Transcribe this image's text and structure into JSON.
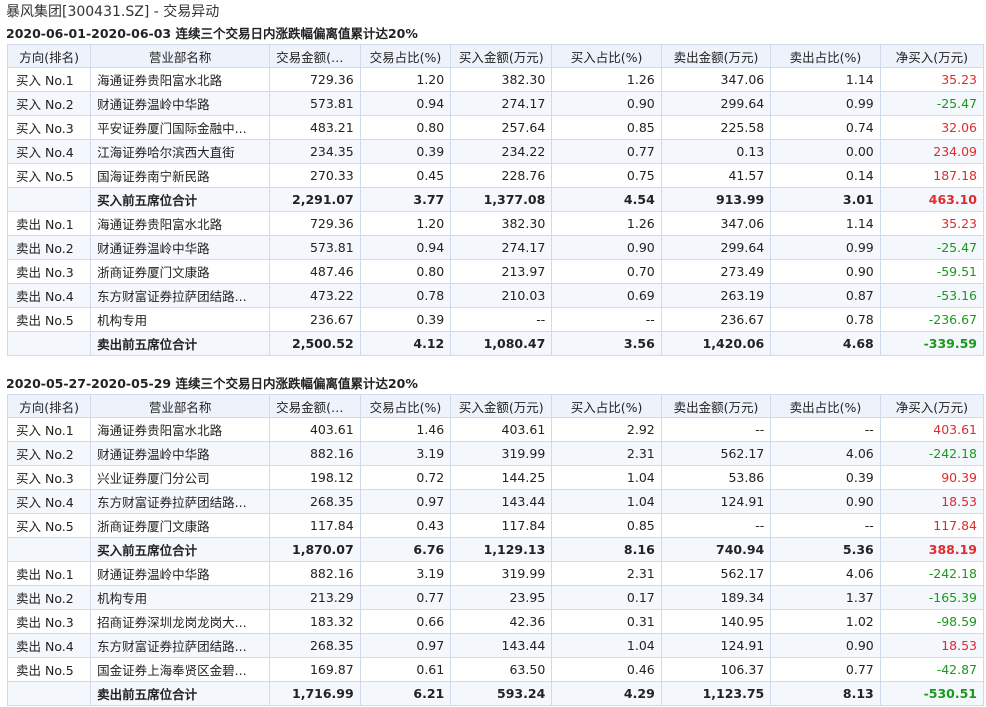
{
  "page_title": "暴风集团[300431.SZ] - 交易异动",
  "columns": [
    "方向(排名)",
    "营业部名称",
    "交易金额(万元)",
    "交易占比(%)",
    "买入金额(万元)",
    "买入占比(%)",
    "卖出金额(万元)",
    "卖出占比(%)",
    "净买入(万元)"
  ],
  "sections": [
    {
      "title": "2020-06-01-2020-06-03 连续三个交易日内涨跌幅偏离值累计达20%",
      "rows": [
        {
          "dir": "买入 No.1",
          "dept": "海通证券贵阳富水北路",
          "amt": "729.36",
          "ratio": "1.20",
          "buy": "382.30",
          "buy_ratio": "1.26",
          "sell": "347.06",
          "sell_ratio": "1.14",
          "net": "35.23",
          "total": false
        },
        {
          "dir": "买入 No.2",
          "dept": "财通证券温岭中华路",
          "amt": "573.81",
          "ratio": "0.94",
          "buy": "274.17",
          "buy_ratio": "0.90",
          "sell": "299.64",
          "sell_ratio": "0.99",
          "net": "-25.47",
          "total": false
        },
        {
          "dir": "买入 No.3",
          "dept": "平安证券厦门国际金融中...",
          "amt": "483.21",
          "ratio": "0.80",
          "buy": "257.64",
          "buy_ratio": "0.85",
          "sell": "225.58",
          "sell_ratio": "0.74",
          "net": "32.06",
          "total": false
        },
        {
          "dir": "买入 No.4",
          "dept": "江海证券哈尔滨西大直街",
          "amt": "234.35",
          "ratio": "0.39",
          "buy": "234.22",
          "buy_ratio": "0.77",
          "sell": "0.13",
          "sell_ratio": "0.00",
          "net": "234.09",
          "total": false
        },
        {
          "dir": "买入 No.5",
          "dept": "国海证券南宁新民路",
          "amt": "270.33",
          "ratio": "0.45",
          "buy": "228.76",
          "buy_ratio": "0.75",
          "sell": "41.57",
          "sell_ratio": "0.14",
          "net": "187.18",
          "total": false
        },
        {
          "dir": "",
          "dept": "买入前五席位合计",
          "amt": "2,291.07",
          "ratio": "3.77",
          "buy": "1,377.08",
          "buy_ratio": "4.54",
          "sell": "913.99",
          "sell_ratio": "3.01",
          "net": "463.10",
          "total": true
        },
        {
          "dir": "卖出 No.1",
          "dept": "海通证券贵阳富水北路",
          "amt": "729.36",
          "ratio": "1.20",
          "buy": "382.30",
          "buy_ratio": "1.26",
          "sell": "347.06",
          "sell_ratio": "1.14",
          "net": "35.23",
          "total": false
        },
        {
          "dir": "卖出 No.2",
          "dept": "财通证券温岭中华路",
          "amt": "573.81",
          "ratio": "0.94",
          "buy": "274.17",
          "buy_ratio": "0.90",
          "sell": "299.64",
          "sell_ratio": "0.99",
          "net": "-25.47",
          "total": false
        },
        {
          "dir": "卖出 No.3",
          "dept": "浙商证券厦门文康路",
          "amt": "487.46",
          "ratio": "0.80",
          "buy": "213.97",
          "buy_ratio": "0.70",
          "sell": "273.49",
          "sell_ratio": "0.90",
          "net": "-59.51",
          "total": false
        },
        {
          "dir": "卖出 No.4",
          "dept": "东方财富证券拉萨团结路...",
          "amt": "473.22",
          "ratio": "0.78",
          "buy": "210.03",
          "buy_ratio": "0.69",
          "sell": "263.19",
          "sell_ratio": "0.87",
          "net": "-53.16",
          "total": false
        },
        {
          "dir": "卖出 No.5",
          "dept": "机构专用",
          "amt": "236.67",
          "ratio": "0.39",
          "buy": "--",
          "buy_ratio": "--",
          "sell": "236.67",
          "sell_ratio": "0.78",
          "net": "-236.67",
          "total": false
        },
        {
          "dir": "",
          "dept": "卖出前五席位合计",
          "amt": "2,500.52",
          "ratio": "4.12",
          "buy": "1,080.47",
          "buy_ratio": "3.56",
          "sell": "1,420.06",
          "sell_ratio": "4.68",
          "net": "-339.59",
          "total": true
        }
      ]
    },
    {
      "title": "2020-05-27-2020-05-29 连续三个交易日内涨跌幅偏离值累计达20%",
      "rows": [
        {
          "dir": "买入 No.1",
          "dept": "海通证券贵阳富水北路",
          "amt": "403.61",
          "ratio": "1.46",
          "buy": "403.61",
          "buy_ratio": "2.92",
          "sell": "--",
          "sell_ratio": "--",
          "net": "403.61",
          "total": false
        },
        {
          "dir": "买入 No.2",
          "dept": "财通证券温岭中华路",
          "amt": "882.16",
          "ratio": "3.19",
          "buy": "319.99",
          "buy_ratio": "2.31",
          "sell": "562.17",
          "sell_ratio": "4.06",
          "net": "-242.18",
          "total": false
        },
        {
          "dir": "买入 No.3",
          "dept": "兴业证券厦门分公司",
          "amt": "198.12",
          "ratio": "0.72",
          "buy": "144.25",
          "buy_ratio": "1.04",
          "sell": "53.86",
          "sell_ratio": "0.39",
          "net": "90.39",
          "total": false
        },
        {
          "dir": "买入 No.4",
          "dept": "东方财富证券拉萨团结路...",
          "amt": "268.35",
          "ratio": "0.97",
          "buy": "143.44",
          "buy_ratio": "1.04",
          "sell": "124.91",
          "sell_ratio": "0.90",
          "net": "18.53",
          "total": false
        },
        {
          "dir": "买入 No.5",
          "dept": "浙商证券厦门文康路",
          "amt": "117.84",
          "ratio": "0.43",
          "buy": "117.84",
          "buy_ratio": "0.85",
          "sell": "--",
          "sell_ratio": "--",
          "net": "117.84",
          "total": false
        },
        {
          "dir": "",
          "dept": "买入前五席位合计",
          "amt": "1,870.07",
          "ratio": "6.76",
          "buy": "1,129.13",
          "buy_ratio": "8.16",
          "sell": "740.94",
          "sell_ratio": "5.36",
          "net": "388.19",
          "total": true
        },
        {
          "dir": "卖出 No.1",
          "dept": "财通证券温岭中华路",
          "amt": "882.16",
          "ratio": "3.19",
          "buy": "319.99",
          "buy_ratio": "2.31",
          "sell": "562.17",
          "sell_ratio": "4.06",
          "net": "-242.18",
          "total": false
        },
        {
          "dir": "卖出 No.2",
          "dept": "机构专用",
          "amt": "213.29",
          "ratio": "0.77",
          "buy": "23.95",
          "buy_ratio": "0.17",
          "sell": "189.34",
          "sell_ratio": "1.37",
          "net": "-165.39",
          "total": false
        },
        {
          "dir": "卖出 No.3",
          "dept": "招商证券深圳龙岗龙岗大...",
          "amt": "183.32",
          "ratio": "0.66",
          "buy": "42.36",
          "buy_ratio": "0.31",
          "sell": "140.95",
          "sell_ratio": "1.02",
          "net": "-98.59",
          "total": false
        },
        {
          "dir": "卖出 No.4",
          "dept": "东方财富证券拉萨团结路...",
          "amt": "268.35",
          "ratio": "0.97",
          "buy": "143.44",
          "buy_ratio": "1.04",
          "sell": "124.91",
          "sell_ratio": "0.90",
          "net": "18.53",
          "total": false
        },
        {
          "dir": "卖出 No.5",
          "dept": "国金证券上海奉贤区金碧...",
          "amt": "169.87",
          "ratio": "0.61",
          "buy": "63.50",
          "buy_ratio": "0.46",
          "sell": "106.37",
          "sell_ratio": "0.77",
          "net": "-42.87",
          "total": false
        },
        {
          "dir": "",
          "dept": "卖出前五席位合计",
          "amt": "1,716.99",
          "ratio": "6.21",
          "buy": "593.24",
          "buy_ratio": "4.29",
          "sell": "1,123.75",
          "sell_ratio": "8.13",
          "net": "-530.51",
          "total": true
        }
      ]
    }
  ]
}
